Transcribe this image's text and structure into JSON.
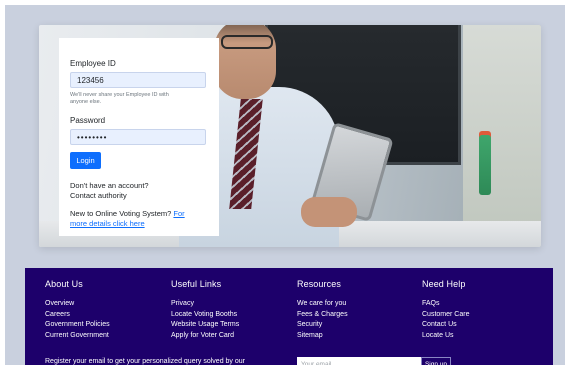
{
  "login": {
    "employee_id_label": "Employee ID",
    "employee_id_value": "123456",
    "employee_id_help_line1": "We'll never share your Employee ID with",
    "employee_id_help_line2": "anyone else.",
    "password_label": "Password",
    "password_value": "••••••••",
    "login_button": "Login",
    "no_account": "Don't have an account?",
    "contact_authority": "Contact authority",
    "new_user_prefix": "New to Online Voting System?",
    "new_user_link_part1": "For",
    "new_user_link_part2": "more details click here"
  },
  "footer": {
    "about": {
      "heading": "About Us",
      "links": [
        "Overview",
        "Careers",
        "Government Policies",
        "Current Government"
      ]
    },
    "useful": {
      "heading": "Useful Links",
      "links": [
        "Privacy",
        "Locate Voting Booths",
        "Website Usage Terms",
        "Apply for Voter Card"
      ]
    },
    "resources": {
      "heading": "Resources",
      "links": [
        "We care for you",
        "Fees & Charges",
        "Security",
        "Sitemap"
      ]
    },
    "help": {
      "heading": "Need Help",
      "links": [
        "FAQs",
        "Customer Care",
        "Contact Us",
        "Locate Us"
      ]
    },
    "newsletter": {
      "text": "Register your email to get your personalized query solved by our",
      "placeholder": "Your email",
      "button": "Sign up"
    }
  },
  "colors": {
    "footer_bg": "#1d006b",
    "page_bg": "#c9d0de",
    "accent": "#0d6efd"
  }
}
